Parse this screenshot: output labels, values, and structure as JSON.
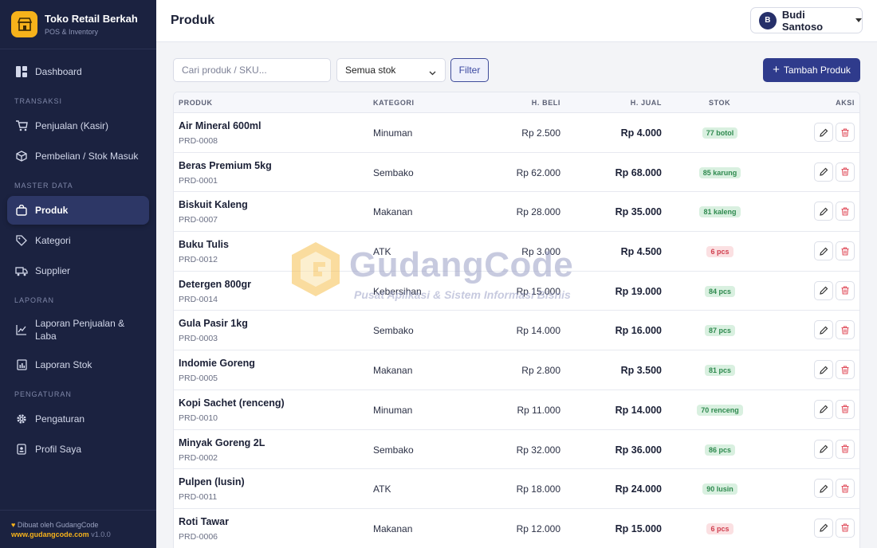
{
  "brand": {
    "title": "Toko Retail Berkah",
    "subtitle": "POS & Inventory"
  },
  "sidebar": {
    "items": [
      {
        "label": "Dashboard",
        "icon": "dashboard-icon"
      },
      {
        "section": "TRANSAKSI"
      },
      {
        "label": "Penjualan (Kasir)",
        "icon": "cart-icon"
      },
      {
        "label": "Pembelian / Stok Masuk",
        "icon": "box-icon"
      },
      {
        "section": "MASTER DATA"
      },
      {
        "label": "Produk",
        "icon": "bag-icon",
        "active": true
      },
      {
        "label": "Kategori",
        "icon": "tag-icon"
      },
      {
        "label": "Supplier",
        "icon": "truck-icon"
      },
      {
        "section": "LAPORAN"
      },
      {
        "label": "Laporan Penjualan & Laba",
        "icon": "chart-line-icon"
      },
      {
        "label": "Laporan Stok",
        "icon": "report-icon"
      },
      {
        "section": "PENGATURAN"
      },
      {
        "label": "Pengaturan",
        "icon": "gear-icon"
      },
      {
        "label": "Profil Saya",
        "icon": "id-card-icon"
      }
    ],
    "footer": {
      "credit": "Dibuat oleh GudangCode",
      "url": "www.gudangcode.com",
      "version": "v1.0.0"
    }
  },
  "header": {
    "title": "Produk",
    "user": {
      "initial": "B",
      "name": "Budi Santoso"
    }
  },
  "toolbar": {
    "search_placeholder": "Cari produk / SKU...",
    "stock_filter": "Semua stok",
    "filter_label": "Filter",
    "add_label": "Tambah Produk"
  },
  "table": {
    "columns": [
      "PRODUK",
      "KATEGORI",
      "H. BELI",
      "H. JUAL",
      "STOK",
      "AKSI"
    ],
    "rows": [
      {
        "name": "Air Mineral 600ml",
        "sku": "PRD-0008",
        "category": "Minuman",
        "buy": "Rp 2.500",
        "sell": "Rp 4.000",
        "stock": "77 botol",
        "low": false
      },
      {
        "name": "Beras Premium 5kg",
        "sku": "PRD-0001",
        "category": "Sembako",
        "buy": "Rp 62.000",
        "sell": "Rp 68.000",
        "stock": "85 karung",
        "low": false
      },
      {
        "name": "Biskuit Kaleng",
        "sku": "PRD-0007",
        "category": "Makanan",
        "buy": "Rp 28.000",
        "sell": "Rp 35.000",
        "stock": "81 kaleng",
        "low": false
      },
      {
        "name": "Buku Tulis",
        "sku": "PRD-0012",
        "category": "ATK",
        "buy": "Rp 3.000",
        "sell": "Rp 4.500",
        "stock": "6 pcs",
        "low": true
      },
      {
        "name": "Detergen 800gr",
        "sku": "PRD-0014",
        "category": "Kebersihan",
        "buy": "Rp 15.000",
        "sell": "Rp 19.000",
        "stock": "84 pcs",
        "low": false
      },
      {
        "name": "Gula Pasir 1kg",
        "sku": "PRD-0003",
        "category": "Sembako",
        "buy": "Rp 14.000",
        "sell": "Rp 16.000",
        "stock": "87 pcs",
        "low": false
      },
      {
        "name": "Indomie Goreng",
        "sku": "PRD-0005",
        "category": "Makanan",
        "buy": "Rp 2.800",
        "sell": "Rp 3.500",
        "stock": "81 pcs",
        "low": false
      },
      {
        "name": "Kopi Sachet (renceng)",
        "sku": "PRD-0010",
        "category": "Minuman",
        "buy": "Rp 11.000",
        "sell": "Rp 14.000",
        "stock": "70 renceng",
        "low": false
      },
      {
        "name": "Minyak Goreng 2L",
        "sku": "PRD-0002",
        "category": "Sembako",
        "buy": "Rp 32.000",
        "sell": "Rp 36.000",
        "stock": "86 pcs",
        "low": false
      },
      {
        "name": "Pulpen (lusin)",
        "sku": "PRD-0011",
        "category": "ATK",
        "buy": "Rp 18.000",
        "sell": "Rp 24.000",
        "stock": "90 lusin",
        "low": false
      },
      {
        "name": "Roti Tawar",
        "sku": "PRD-0006",
        "category": "Makanan",
        "buy": "Rp 12.000",
        "sell": "Rp 15.000",
        "stock": "6 pcs",
        "low": true
      }
    ]
  },
  "watermark": {
    "title": "GudangCode",
    "subtitle": "Pusat Aplikasi & Sistem Informasi Bisnis"
  },
  "colors": {
    "sidebar_bg": "#1b2240",
    "accent": "#2f3b8c",
    "brand_yellow": "#f6b21b",
    "stock_ok": "#2f8a4f",
    "stock_low": "#d04050"
  }
}
